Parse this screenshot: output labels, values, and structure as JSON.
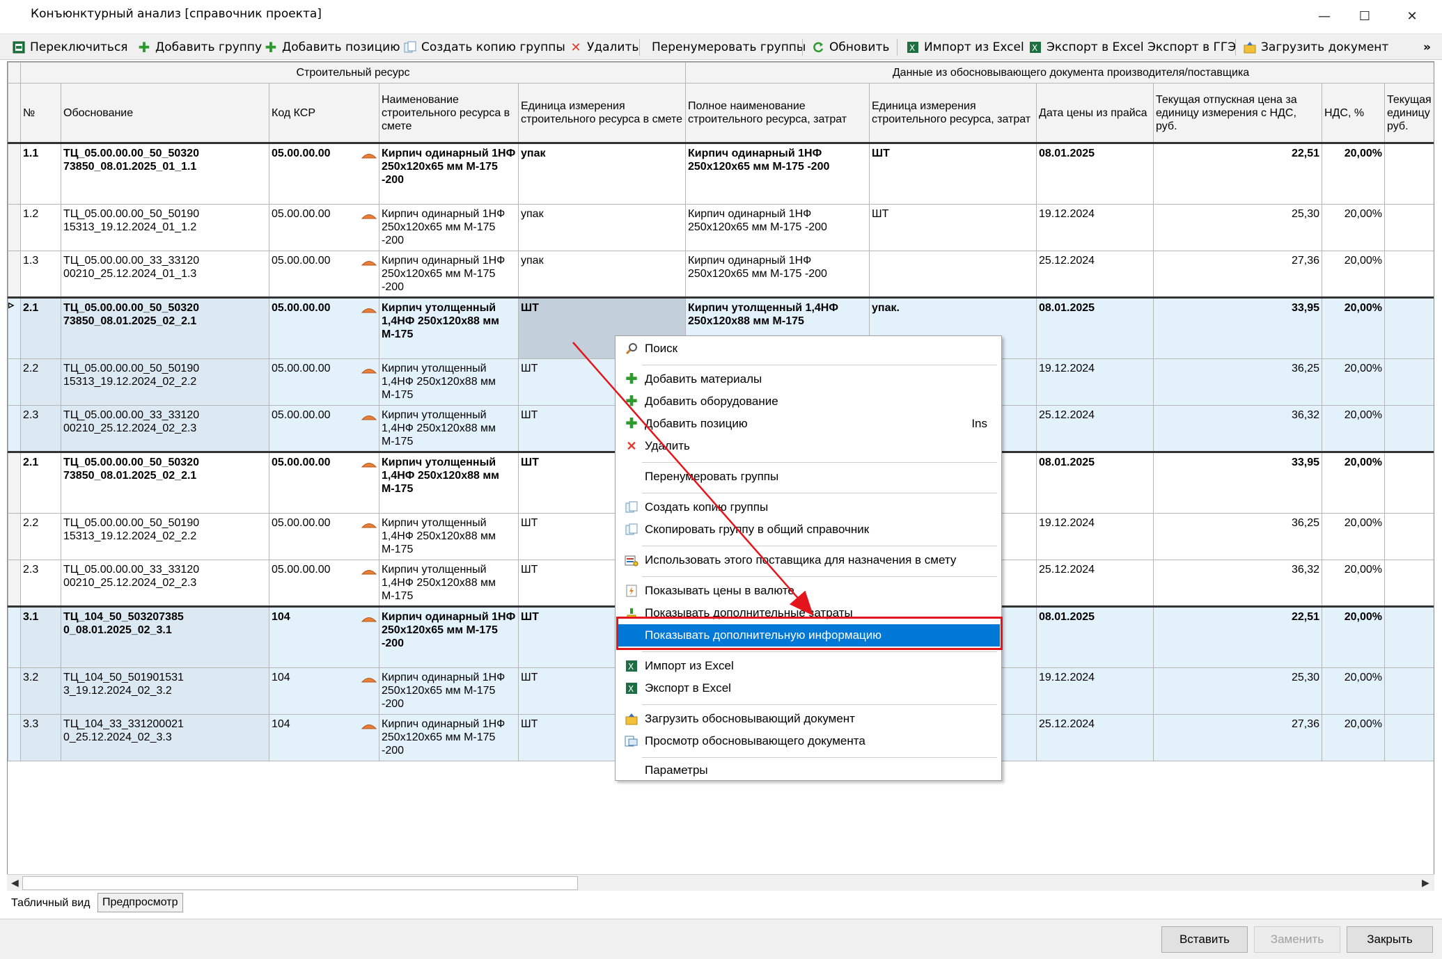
{
  "window": {
    "title": "Конъюнктурный анализ [справочник проекта]",
    "minimize": "—",
    "maximize": "☐",
    "close": "✕"
  },
  "toolbar": {
    "switch": "Переключиться",
    "add_group": "Добавить группу",
    "add_position": "Добавить позицию",
    "copy_group": "Создать копию группы",
    "delete": "Удалить",
    "renumber": "Перенумеровать группы",
    "refresh": "Обновить",
    "import_excel": "Импорт из Excel",
    "export_excel": "Экспорт в Excel",
    "export_gge": "Экспорт в ГГЭ",
    "load_doc": "Загрузить документ",
    "overflow": "»"
  },
  "grid": {
    "group_headers": [
      "Строительный ресурс",
      "Данные из обосновывающего документа производителя/поставщика"
    ],
    "columns": [
      "№",
      "Обоснование",
      "Код КСР",
      "Наименование строительного ресурса в смете",
      "Единица измерения строительного ресурса в смете",
      "Полное наименование строительного ресурса, затрат",
      "Единица измерения строительного ресурса, затрат",
      "Дата цены из прайса",
      "Текущая отпускная цена за единицу измерения с НДС, руб.",
      "НДС, %",
      "Текущая единицу и руб."
    ],
    "rows": [
      {
        "n": "1.1",
        "osn": "ТЦ_05.00.00.00_50_50320\n73850_08.01.2025_01_1.1",
        "ksr": "05.00.00.00",
        "name": "Кирпич одинарный 1НФ 250х120х65 мм М-175 -200",
        "unit": "упак",
        "full": "Кирпич одинарный 1НФ 250х120х65 мм М-175 -200",
        "unit2": "ШТ",
        "date": "08.01.2025",
        "price": "22,51",
        "nds": "20,00%"
      },
      {
        "n": "1.2",
        "osn": "ТЦ_05.00.00.00_50_50190\n15313_19.12.2024_01_1.2",
        "ksr": "05.00.00.00",
        "name": "Кирпич одинарный 1НФ 250х120х65 мм М-175 -200",
        "unit": "упак",
        "full": "Кирпич одинарный 1НФ 250х120х65 мм М-175 -200",
        "unit2": "ШТ",
        "date": "19.12.2024",
        "price": "25,30",
        "nds": "20,00%"
      },
      {
        "n": "1.3",
        "osn": "ТЦ_05.00.00.00_33_33120\n00210_25.12.2024_01_1.3",
        "ksr": "05.00.00.00",
        "name": "Кирпич одинарный 1НФ 250х120х65 мм М-175 -200",
        "unit": "упак",
        "full": "Кирпич одинарный 1НФ 250х120х65 мм М-175 -200",
        "unit2": "",
        "date": "25.12.2024",
        "price": "27,36",
        "nds": "20,00%"
      },
      {
        "n": "2.1",
        "osn": "ТЦ_05.00.00.00_50_50320\n73850_08.01.2025_02_2.1",
        "ksr": "05.00.00.00",
        "name": "Кирпич утолщенный 1,4НФ 250х120х88 мм М-175",
        "unit": "ШТ",
        "full": "Кирпич утолщенный 1,4НФ 250х120х88 мм М-175",
        "unit2": "упак.",
        "date": "08.01.2025",
        "price": "33,95",
        "nds": "20,00%"
      },
      {
        "n": "2.2",
        "osn": "ТЦ_05.00.00.00_50_50190\n15313_19.12.2024_02_2.2",
        "ksr": "05.00.00.00",
        "name": "Кирпич утолщенный 1,4НФ 250х120х88 мм М-175",
        "unit": "ШТ",
        "full": "",
        "unit2": "",
        "date": "19.12.2024",
        "price": "36,25",
        "nds": "20,00%"
      },
      {
        "n": "2.3",
        "osn": "ТЦ_05.00.00.00_33_33120\n00210_25.12.2024_02_2.3",
        "ksr": "05.00.00.00",
        "name": "Кирпич утолщенный 1,4НФ 250х120х88 мм М-175",
        "unit": "ШТ",
        "full": "",
        "unit2": "",
        "date": "25.12.2024",
        "price": "36,32",
        "nds": "20,00%"
      },
      {
        "n": "2.1",
        "osn": "ТЦ_05.00.00.00_50_50320\n73850_08.01.2025_02_2.1",
        "ksr": "05.00.00.00",
        "name": "Кирпич утолщенный 1,4НФ 250х120х88 мм М-175",
        "unit": "ШТ",
        "full": "",
        "unit2": "",
        "date": "08.01.2025",
        "price": "33,95",
        "nds": "20,00%"
      },
      {
        "n": "2.2",
        "osn": "ТЦ_05.00.00.00_50_50190\n15313_19.12.2024_02_2.2",
        "ksr": "05.00.00.00",
        "name": "Кирпич утолщенный 1,4НФ 250х120х88 мм М-175",
        "unit": "ШТ",
        "full": "",
        "unit2": "",
        "date": "19.12.2024",
        "price": "36,25",
        "nds": "20,00%"
      },
      {
        "n": "2.3",
        "osn": "ТЦ_05.00.00.00_33_33120\n00210_25.12.2024_02_2.3",
        "ksr": "05.00.00.00",
        "name": "Кирпич утолщенный 1,4НФ 250х120х88 мм М-175",
        "unit": "ШТ",
        "full": "",
        "unit2": "",
        "date": "25.12.2024",
        "price": "36,32",
        "nds": "20,00%"
      },
      {
        "n": "3.1",
        "osn": "ТЦ_104_50_503207385\n0_08.01.2025_02_3.1",
        "ksr": "104",
        "name": "Кирпич одинарный 1НФ 250х120х65 мм М-175 -200",
        "unit": "ШТ",
        "full": "",
        "unit2": "",
        "date": "08.01.2025",
        "price": "22,51",
        "nds": "20,00%"
      },
      {
        "n": "3.2",
        "osn": "ТЦ_104_50_501901531\n3_19.12.2024_02_3.2",
        "ksr": "104",
        "name": "Кирпич одинарный 1НФ 250х120х65 мм М-175 -200",
        "unit": "ШТ",
        "full": "",
        "unit2": "",
        "date": "19.12.2024",
        "price": "25,30",
        "nds": "20,00%"
      },
      {
        "n": "3.3",
        "osn": "ТЦ_104_33_331200021\n0_25.12.2024_02_3.3",
        "ksr": "104",
        "name": "Кирпич одинарный 1НФ 250х120х65 мм М-175 -200",
        "unit": "ШТ",
        "full": "",
        "unit2": "",
        "date": "25.12.2024",
        "price": "27,36",
        "nds": "20,00%"
      }
    ]
  },
  "context_menu": {
    "search": "Поиск",
    "add_materials": "Добавить материалы",
    "add_equipment": "Добавить оборудование",
    "add_position": "Добавить позицию",
    "add_position_shortcut": "Ins",
    "delete": "Удалить",
    "renumber": "Перенумеровать группы",
    "copy_group": "Создать копию группы",
    "copy_to_common": "Скопировать группу в общий справочник",
    "use_supplier": "Использовать этого поставщика для назначения в смету",
    "show_currency": "Показывать цены в валюте",
    "show_extra_costs": "Показывать дополнительные затраты",
    "show_extra_info": "Показывать дополнительную информацию",
    "import_excel": "Импорт из Excel",
    "export_excel": "Экспорт в Excel",
    "load_doc": "Загрузить обосновывающий документ",
    "view_doc": "Просмотр обосновывающего документа",
    "params": "Параметры"
  },
  "tabs": {
    "table": "Табличный вид",
    "preview": "Предпросмотр"
  },
  "footer": {
    "insert": "Вставить",
    "replace": "Заменить",
    "close": "Закрыть"
  },
  "colors": {
    "accent": "#0078d7",
    "highlight_border": "#e3141b",
    "arrow": "#e3141b",
    "selected_row": "#e3f1fb"
  }
}
